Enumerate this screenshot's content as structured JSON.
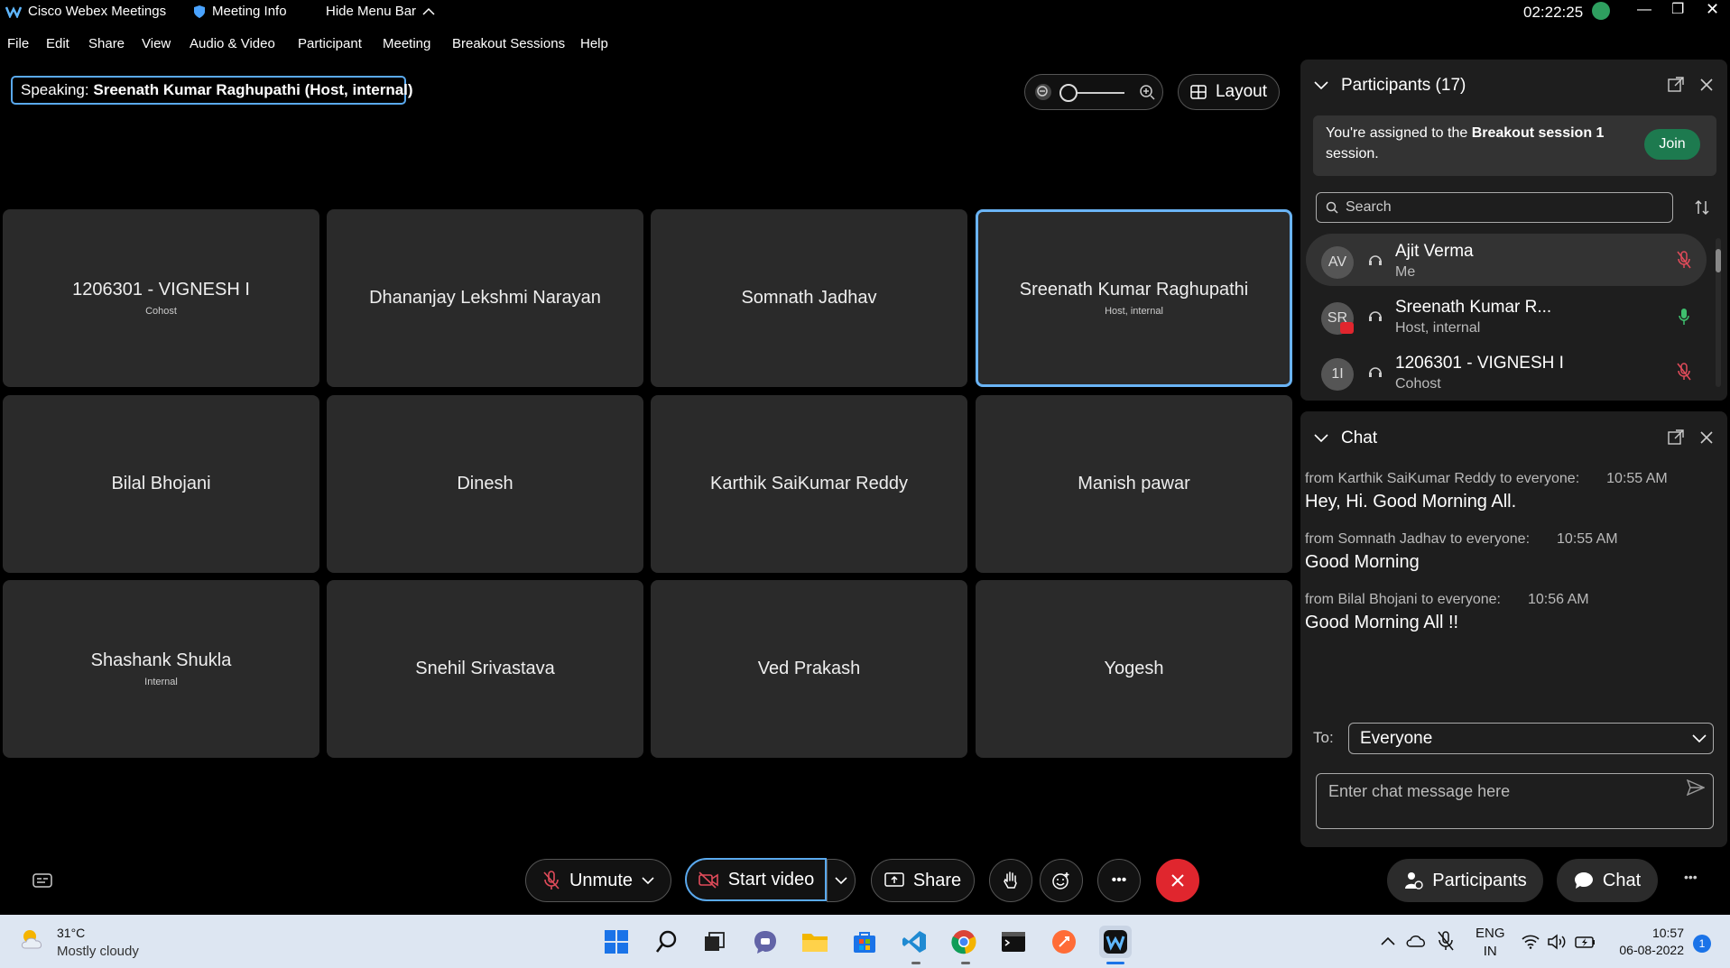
{
  "titlebar": {
    "app_name": "Cisco Webex Meetings",
    "meeting_info": "Meeting Info",
    "hide_menu_bar": "Hide Menu Bar",
    "clock": "02:22:25"
  },
  "menu": [
    "File",
    "Edit",
    "Share",
    "View",
    "Audio & Video",
    "Participant",
    "Meeting",
    "Breakout Sessions",
    "Help"
  ],
  "speaking": {
    "label": "Speaking:",
    "name": "Sreenath Kumar Raghupathi (Host, internal)"
  },
  "layout_button": "Layout",
  "tiles": [
    {
      "name": "1206301 - VIGNESH I",
      "sub": "Cohost"
    },
    {
      "name": "Dhananjay Lekshmi Narayan",
      "sub": ""
    },
    {
      "name": "Somnath Jadhav",
      "sub": ""
    },
    {
      "name": "Sreenath Kumar Raghupathi",
      "sub": "Host, internal"
    },
    {
      "name": "Bilal Bhojani",
      "sub": ""
    },
    {
      "name": "Dinesh",
      "sub": ""
    },
    {
      "name": "Karthik SaiKumar Reddy",
      "sub": ""
    },
    {
      "name": "Manish pawar",
      "sub": ""
    },
    {
      "name": "Shashank Shukla",
      "sub": "Internal"
    },
    {
      "name": "Snehil Srivastava",
      "sub": ""
    },
    {
      "name": "Ved Prakash",
      "sub": ""
    },
    {
      "name": "Yogesh",
      "sub": ""
    }
  ],
  "participants_panel": {
    "title": "Participants (17)",
    "assign_prefix": "You're assigned to the ",
    "assign_session": "Breakout session 1",
    "assign_suffix": "session.",
    "join_button": "Join",
    "search_placeholder": "Search",
    "rows": [
      {
        "initials": "AV",
        "name": "Ajit Verma",
        "role": "Me"
      },
      {
        "initials": "SR",
        "name": "Sreenath Kumar R...",
        "role": "Host, internal"
      },
      {
        "initials": "1I",
        "name": "1206301 - VIGNESH I",
        "role": "Cohost"
      }
    ]
  },
  "chat_panel": {
    "title": "Chat",
    "messages": [
      {
        "from": "from Karthik SaiKumar Reddy to everyone:",
        "time": "10:55 AM",
        "text": "Hey, Hi. Good Morning All."
      },
      {
        "from": "from Somnath Jadhav to everyone:",
        "time": "10:55 AM",
        "text": "Good Morning"
      },
      {
        "from": "from Bilal Bhojani to everyone:",
        "time": "10:56 AM",
        "text": "Good Morning All !!"
      }
    ],
    "to_label": "To:",
    "to_value": "Everyone",
    "input_placeholder": "Enter chat message here"
  },
  "controls": {
    "unmute": "Unmute",
    "start_video": "Start video",
    "share": "Share",
    "participants": "Participants",
    "chat": "Chat"
  },
  "taskbar": {
    "temperature": "31°C",
    "weather": "Mostly cloudy",
    "lang1": "ENG",
    "lang2": "IN",
    "time": "10:57",
    "date": "06-08-2022",
    "notification_count": "1"
  },
  "colors": {
    "accent_blue": "#5aa9ee",
    "join_green": "#1d7a4f",
    "leave_red": "#e0262e",
    "mic_green": "#3fbf6e",
    "mic_muted_red": "#e14b5a"
  }
}
